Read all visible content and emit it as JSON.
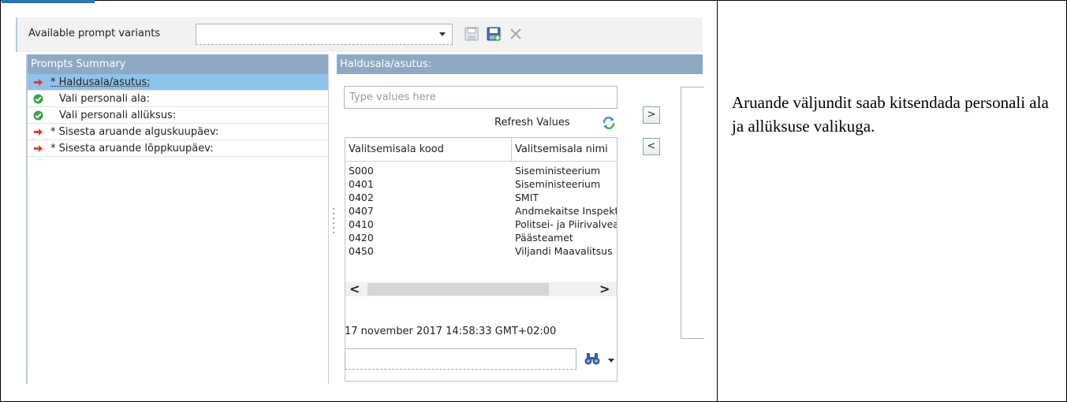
{
  "toolbar": {
    "variants_label": "Available prompt variants",
    "variant_value": "",
    "icons": [
      "save-icon",
      "save-new-icon",
      "delete-icon"
    ]
  },
  "summary": {
    "header": "Prompts Summary",
    "items": [
      {
        "label": "* Haldusala/asutus:",
        "status": "required",
        "selected": true
      },
      {
        "label": "Vali personali ala:",
        "status": "ok",
        "selected": false
      },
      {
        "label": "Vali personali allüksus:",
        "status": "ok",
        "selected": false
      },
      {
        "label": "* Sisesta aruande alguskuupäev:",
        "status": "required",
        "selected": false
      },
      {
        "label": "* Sisesta aruande lõppkuupäev:",
        "status": "required",
        "selected": false
      }
    ]
  },
  "values": {
    "header": "Haldusala/asutus:",
    "input_placeholder": "Type values here",
    "refresh_label": "Refresh Values",
    "columns": [
      "Valitsemisala kood",
      "Valitsemisala nimi"
    ],
    "rows": [
      [
        "S000",
        "Siseministeerium"
      ],
      [
        "0401",
        "Siseministeerium"
      ],
      [
        "0402",
        "SMIT"
      ],
      [
        "0407",
        "Andmekaitse Inspektsioon"
      ],
      [
        "0410",
        "Politsei- ja Piirivalveamet"
      ],
      [
        "0420",
        "Päästeamet"
      ],
      [
        "0450",
        "Viljandi Maavalitsus"
      ]
    ],
    "timestamp": "17 november 2017 14:58:33 GMT+02:00",
    "search_value": "",
    "add_label": ">",
    "remove_label": "<"
  },
  "description": "Aruande väljundit saab kitsendada personali ala ja allüksuse valikuga."
}
